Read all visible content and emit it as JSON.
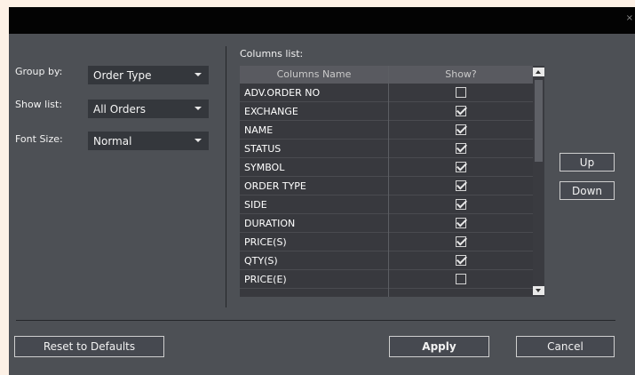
{
  "window": {
    "close_glyph": "×"
  },
  "settings": {
    "group_by": {
      "label": "Group by:",
      "value": "Order Type"
    },
    "show_list": {
      "label": "Show list:",
      "value": "All Orders"
    },
    "font_size": {
      "label": "Font Size:",
      "value": "Normal"
    }
  },
  "columns_list": {
    "label": "Columns list:",
    "headers": {
      "name": "Columns Name",
      "show": "Show?"
    },
    "rows": [
      {
        "name": "ADV.ORDER NO",
        "show": false
      },
      {
        "name": "EXCHANGE",
        "show": true
      },
      {
        "name": "NAME",
        "show": true
      },
      {
        "name": "STATUS",
        "show": true
      },
      {
        "name": "SYMBOL",
        "show": true
      },
      {
        "name": "ORDER TYPE",
        "show": true
      },
      {
        "name": "SIDE",
        "show": true
      },
      {
        "name": "DURATION",
        "show": true
      },
      {
        "name": "PRICE(S)",
        "show": true
      },
      {
        "name": "QTY(S)",
        "show": true
      },
      {
        "name": "PRICE(E)",
        "show": false
      }
    ]
  },
  "buttons": {
    "up": "Up",
    "down": "Down",
    "reset": "Reset to Defaults",
    "apply": "Apply",
    "cancel": "Cancel"
  }
}
